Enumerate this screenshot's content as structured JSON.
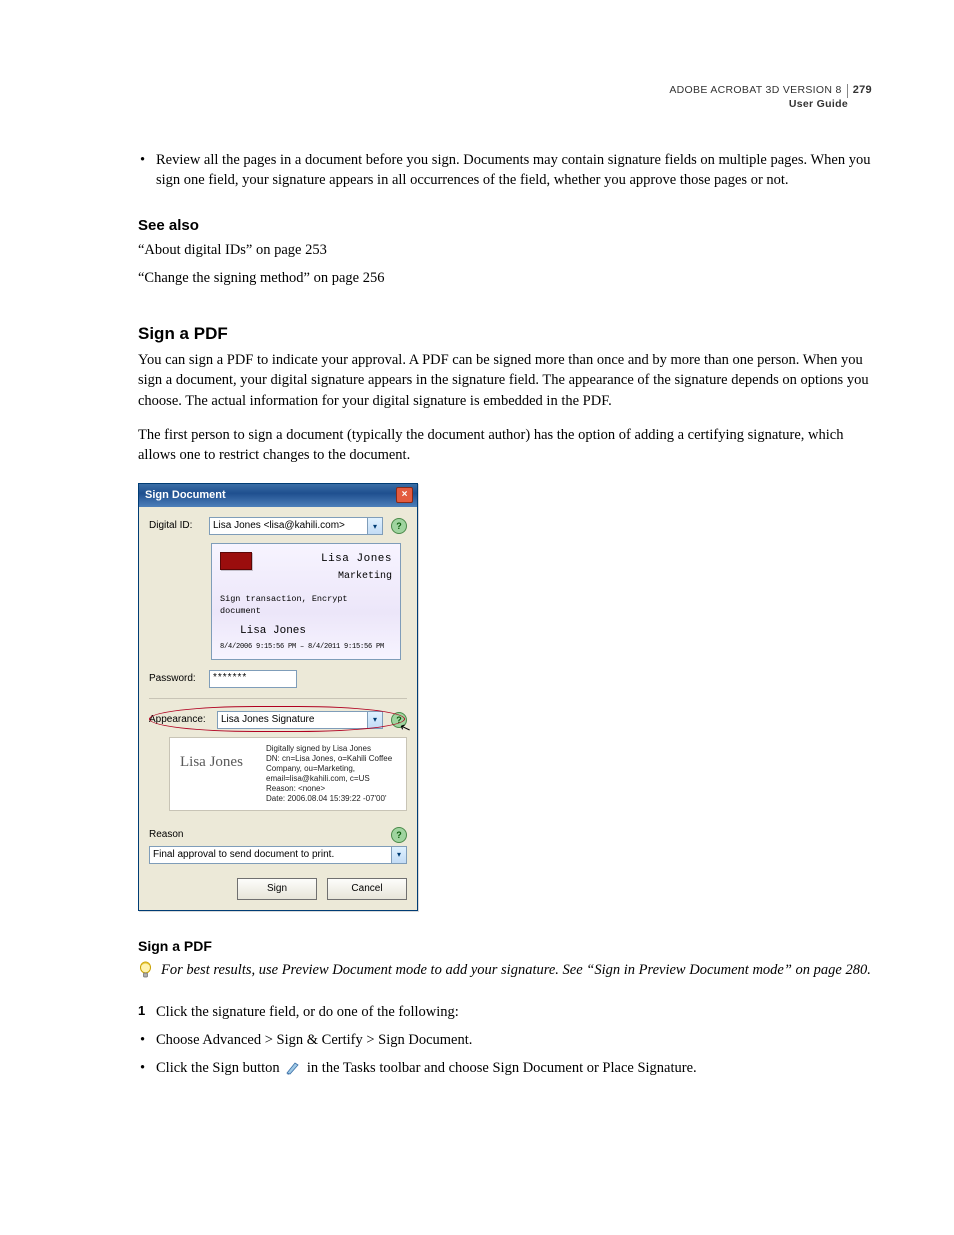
{
  "header": {
    "product": "ADOBE ACROBAT 3D VERSION 8",
    "page_number": "279",
    "subtitle": "User Guide"
  },
  "intro_bullet": "Review all the pages in a document before you sign. Documents may contain signature fields on multiple pages. When you sign one field, your signature appears in all occurrences of the field, whether you approve those pages or not.",
  "see_also": {
    "heading": "See also",
    "ref1": "“About digital IDs” on page 253",
    "ref2": "“Change the signing method” on page 256"
  },
  "section": {
    "title": "Sign a PDF",
    "p1": "You can sign a PDF to indicate your approval. A PDF can be signed more than once and by more than one person. When you sign a document, your digital signature appears in the signature field. The appearance of the signature depends on options you choose. The actual information for your digital signature is embedded in the PDF.",
    "p2": "The first person to sign a document (typically the document author) has the option of adding a certifying signature, which allows one to restrict changes to the document."
  },
  "dialog": {
    "title": "Sign Document",
    "digital_id_label": "Digital ID:",
    "digital_id_value": "Lisa Jones <lisa@kahili.com>",
    "preview_name": "Lisa Jones",
    "preview_dept": "Marketing",
    "preview_line": "Sign transaction, Encrypt document",
    "preview_name2": "Lisa Jones",
    "preview_dates": "8/4/2006 9:15:56 PM – 8/4/2011 9:15:56 PM",
    "password_label": "Password:",
    "password_value": "*******",
    "appearance_label": "Appearance:",
    "appearance_value": "Lisa Jones Signature",
    "sig_script": "Lisa Jones",
    "sig_meta_1": "Digitally signed by Lisa Jones",
    "sig_meta_2": "DN: cn=Lisa Jones, o=Kahili Coffee Company, ou=Marketing, email=lisa@kahili.com, c=US",
    "sig_meta_3": "Reason: <none>",
    "sig_meta_4": "Date: 2006.08.04 15:39:22 -07'00'",
    "reason_label": "Reason",
    "reason_value": "Final approval to send document to print.",
    "sign_btn": "Sign",
    "cancel_btn": "Cancel"
  },
  "subsection": {
    "heading": "Sign a PDF",
    "tip": "For best results, use Preview Document mode to add your signature. See “Sign in Preview Document mode” on page 280.",
    "step1": "Click the signature field, or do one of the following:",
    "sub_a": "Choose Advanced > Sign & Certify > Sign Document.",
    "sub_b_pre": "Click the Sign button ",
    "sub_b_post": " in the Tasks toolbar and choose Sign Document or Place Signature."
  }
}
